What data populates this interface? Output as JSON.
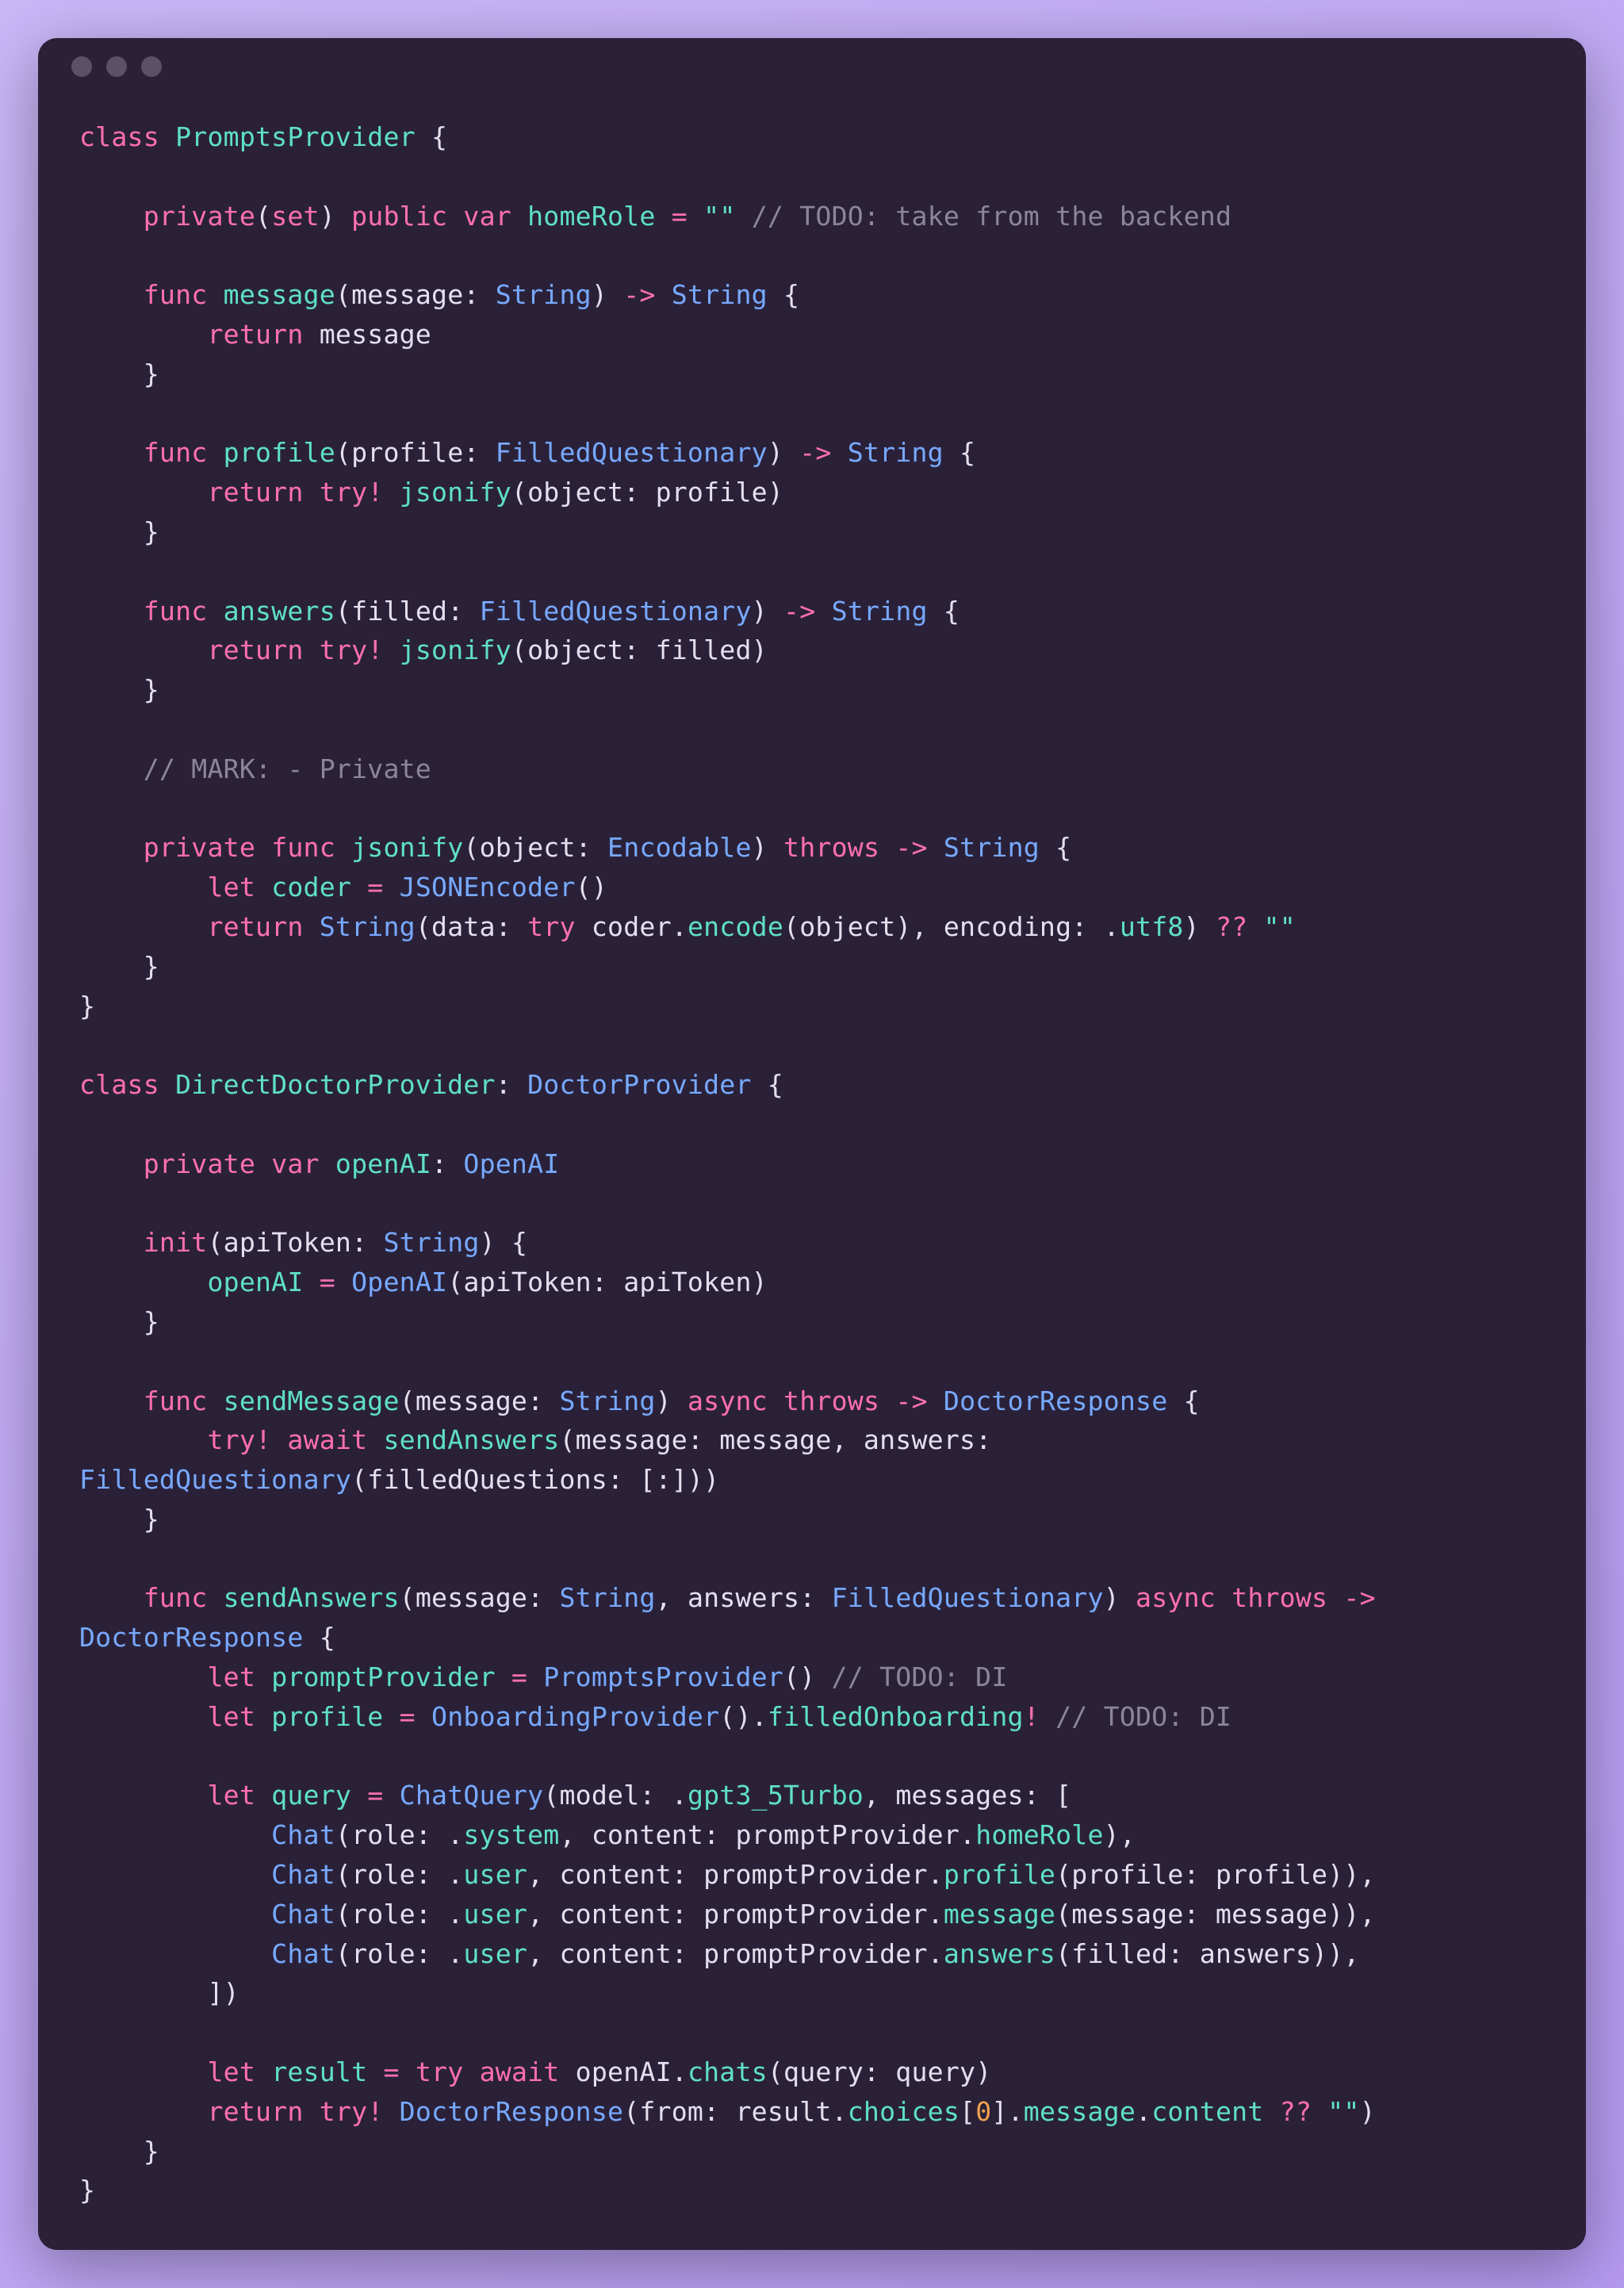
{
  "code_lines": [
    [
      [
        "kw",
        "class"
      ],
      [
        "pln",
        " "
      ],
      [
        "fn",
        "PromptsProvider"
      ],
      [
        "pln",
        " {"
      ]
    ],
    [],
    [
      [
        "pln",
        "    "
      ],
      [
        "kw2",
        "private"
      ],
      [
        "pln",
        "("
      ],
      [
        "kw2",
        "set"
      ],
      [
        "pln",
        ") "
      ],
      [
        "kw2",
        "public"
      ],
      [
        "pln",
        " "
      ],
      [
        "kw",
        "var"
      ],
      [
        "pln",
        " "
      ],
      [
        "fn",
        "homeRole"
      ],
      [
        "pln",
        " "
      ],
      [
        "op",
        "="
      ],
      [
        "pln",
        " "
      ],
      [
        "str",
        "\"\""
      ],
      [
        "pln",
        " "
      ],
      [
        "cmt",
        "// TODO: take from the backend"
      ]
    ],
    [],
    [
      [
        "pln",
        "    "
      ],
      [
        "kw",
        "func"
      ],
      [
        "pln",
        " "
      ],
      [
        "fn",
        "message"
      ],
      [
        "pln",
        "("
      ],
      [
        "lbl",
        "message"
      ],
      [
        "pln",
        ": "
      ],
      [
        "typ",
        "String"
      ],
      [
        "pln",
        ") "
      ],
      [
        "op",
        "->"
      ],
      [
        "pln",
        " "
      ],
      [
        "typ",
        "String"
      ],
      [
        "pln",
        " {"
      ]
    ],
    [
      [
        "pln",
        "        "
      ],
      [
        "kw",
        "return"
      ],
      [
        "pln",
        " message"
      ]
    ],
    [
      [
        "pln",
        "    }"
      ]
    ],
    [],
    [
      [
        "pln",
        "    "
      ],
      [
        "kw",
        "func"
      ],
      [
        "pln",
        " "
      ],
      [
        "fn",
        "profile"
      ],
      [
        "pln",
        "("
      ],
      [
        "lbl",
        "profile"
      ],
      [
        "pln",
        ": "
      ],
      [
        "typ",
        "FilledQuestionary"
      ],
      [
        "pln",
        ") "
      ],
      [
        "op",
        "->"
      ],
      [
        "pln",
        " "
      ],
      [
        "typ",
        "String"
      ],
      [
        "pln",
        " {"
      ]
    ],
    [
      [
        "pln",
        "        "
      ],
      [
        "kw",
        "return"
      ],
      [
        "pln",
        " "
      ],
      [
        "kw",
        "try!"
      ],
      [
        "pln",
        " "
      ],
      [
        "fn",
        "jsonify"
      ],
      [
        "pln",
        "("
      ],
      [
        "lbl",
        "object"
      ],
      [
        "pln",
        ": profile)"
      ]
    ],
    [
      [
        "pln",
        "    }"
      ]
    ],
    [],
    [
      [
        "pln",
        "    "
      ],
      [
        "kw",
        "func"
      ],
      [
        "pln",
        " "
      ],
      [
        "fn",
        "answers"
      ],
      [
        "pln",
        "("
      ],
      [
        "lbl",
        "filled"
      ],
      [
        "pln",
        ": "
      ],
      [
        "typ",
        "FilledQuestionary"
      ],
      [
        "pln",
        ") "
      ],
      [
        "op",
        "->"
      ],
      [
        "pln",
        " "
      ],
      [
        "typ",
        "String"
      ],
      [
        "pln",
        " {"
      ]
    ],
    [
      [
        "pln",
        "        "
      ],
      [
        "kw",
        "return"
      ],
      [
        "pln",
        " "
      ],
      [
        "kw",
        "try!"
      ],
      [
        "pln",
        " "
      ],
      [
        "fn",
        "jsonify"
      ],
      [
        "pln",
        "("
      ],
      [
        "lbl",
        "object"
      ],
      [
        "pln",
        ": filled)"
      ]
    ],
    [
      [
        "pln",
        "    }"
      ]
    ],
    [],
    [
      [
        "pln",
        "    "
      ],
      [
        "cmt",
        "// MARK: - Private"
      ]
    ],
    [],
    [
      [
        "pln",
        "    "
      ],
      [
        "kw2",
        "private"
      ],
      [
        "pln",
        " "
      ],
      [
        "kw",
        "func"
      ],
      [
        "pln",
        " "
      ],
      [
        "fn",
        "jsonify"
      ],
      [
        "pln",
        "("
      ],
      [
        "lbl",
        "object"
      ],
      [
        "pln",
        ": "
      ],
      [
        "typ",
        "Encodable"
      ],
      [
        "pln",
        ") "
      ],
      [
        "kw",
        "throws"
      ],
      [
        "pln",
        " "
      ],
      [
        "op",
        "->"
      ],
      [
        "pln",
        " "
      ],
      [
        "typ",
        "String"
      ],
      [
        "pln",
        " {"
      ]
    ],
    [
      [
        "pln",
        "        "
      ],
      [
        "kw",
        "let"
      ],
      [
        "pln",
        " "
      ],
      [
        "fn",
        "coder"
      ],
      [
        "pln",
        " "
      ],
      [
        "op",
        "="
      ],
      [
        "pln",
        " "
      ],
      [
        "typ",
        "JSONEncoder"
      ],
      [
        "pln",
        "()"
      ]
    ],
    [
      [
        "pln",
        "        "
      ],
      [
        "kw",
        "return"
      ],
      [
        "pln",
        " "
      ],
      [
        "typ",
        "String"
      ],
      [
        "pln",
        "("
      ],
      [
        "lbl",
        "data"
      ],
      [
        "pln",
        ": "
      ],
      [
        "kw",
        "try"
      ],
      [
        "pln",
        " coder."
      ],
      [
        "fn",
        "encode"
      ],
      [
        "pln",
        "(object), "
      ],
      [
        "lbl",
        "encoding"
      ],
      [
        "pln",
        ": ."
      ],
      [
        "fn",
        "utf8"
      ],
      [
        "pln",
        ") "
      ],
      [
        "op",
        "??"
      ],
      [
        "pln",
        " "
      ],
      [
        "str",
        "\"\""
      ]
    ],
    [
      [
        "pln",
        "    }"
      ]
    ],
    [
      [
        "pln",
        "}"
      ]
    ],
    [],
    [
      [
        "kw",
        "class"
      ],
      [
        "pln",
        " "
      ],
      [
        "fn",
        "DirectDoctorProvider"
      ],
      [
        "pln",
        ": "
      ],
      [
        "typ",
        "DoctorProvider"
      ],
      [
        "pln",
        " {"
      ]
    ],
    [],
    [
      [
        "pln",
        "    "
      ],
      [
        "kw2",
        "private"
      ],
      [
        "pln",
        " "
      ],
      [
        "kw",
        "var"
      ],
      [
        "pln",
        " "
      ],
      [
        "fn",
        "openAI"
      ],
      [
        "pln",
        ": "
      ],
      [
        "typ",
        "OpenAI"
      ]
    ],
    [],
    [
      [
        "pln",
        "    "
      ],
      [
        "kw",
        "init"
      ],
      [
        "pln",
        "("
      ],
      [
        "lbl",
        "apiToken"
      ],
      [
        "pln",
        ": "
      ],
      [
        "typ",
        "String"
      ],
      [
        "pln",
        ") {"
      ]
    ],
    [
      [
        "pln",
        "        "
      ],
      [
        "fn",
        "openAI"
      ],
      [
        "pln",
        " "
      ],
      [
        "op",
        "="
      ],
      [
        "pln",
        " "
      ],
      [
        "typ",
        "OpenAI"
      ],
      [
        "pln",
        "("
      ],
      [
        "lbl",
        "apiToken"
      ],
      [
        "pln",
        ": apiToken)"
      ]
    ],
    [
      [
        "pln",
        "    }"
      ]
    ],
    [],
    [
      [
        "pln",
        "    "
      ],
      [
        "kw",
        "func"
      ],
      [
        "pln",
        " "
      ],
      [
        "fn",
        "sendMessage"
      ],
      [
        "pln",
        "("
      ],
      [
        "lbl",
        "message"
      ],
      [
        "pln",
        ": "
      ],
      [
        "typ",
        "String"
      ],
      [
        "pln",
        ") "
      ],
      [
        "kw",
        "async"
      ],
      [
        "pln",
        " "
      ],
      [
        "kw",
        "throws"
      ],
      [
        "pln",
        " "
      ],
      [
        "op",
        "->"
      ],
      [
        "pln",
        " "
      ],
      [
        "typ",
        "DoctorResponse"
      ],
      [
        "pln",
        " {"
      ]
    ],
    [
      [
        "pln",
        "        "
      ],
      [
        "kw",
        "try!"
      ],
      [
        "pln",
        " "
      ],
      [
        "kw",
        "await"
      ],
      [
        "pln",
        " "
      ],
      [
        "fn",
        "sendAnswers"
      ],
      [
        "pln",
        "("
      ],
      [
        "lbl",
        "message"
      ],
      [
        "pln",
        ": message, "
      ],
      [
        "lbl",
        "answers"
      ],
      [
        "pln",
        ": "
      ],
      [
        "typ",
        "FilledQuestionary"
      ],
      [
        "pln",
        "("
      ],
      [
        "lbl",
        "filledQuestions"
      ],
      [
        "pln",
        ": [:]))"
      ]
    ],
    [
      [
        "pln",
        "    }"
      ]
    ],
    [],
    [
      [
        "pln",
        "    "
      ],
      [
        "kw",
        "func"
      ],
      [
        "pln",
        " "
      ],
      [
        "fn",
        "sendAnswers"
      ],
      [
        "pln",
        "("
      ],
      [
        "lbl",
        "message"
      ],
      [
        "pln",
        ": "
      ],
      [
        "typ",
        "String"
      ],
      [
        "pln",
        ", "
      ],
      [
        "lbl",
        "answers"
      ],
      [
        "pln",
        ": "
      ],
      [
        "typ",
        "FilledQuestionary"
      ],
      [
        "pln",
        ") "
      ],
      [
        "kw",
        "async"
      ],
      [
        "pln",
        " "
      ],
      [
        "kw",
        "throws"
      ],
      [
        "pln",
        " "
      ],
      [
        "op",
        "->"
      ],
      [
        "pln",
        " "
      ],
      [
        "typ",
        "DoctorResponse"
      ],
      [
        "pln",
        " {"
      ]
    ],
    [
      [
        "pln",
        "        "
      ],
      [
        "kw",
        "let"
      ],
      [
        "pln",
        " "
      ],
      [
        "fn",
        "promptProvider"
      ],
      [
        "pln",
        " "
      ],
      [
        "op",
        "="
      ],
      [
        "pln",
        " "
      ],
      [
        "typ",
        "PromptsProvider"
      ],
      [
        "pln",
        "() "
      ],
      [
        "cmt",
        "// TODO: DI"
      ]
    ],
    [
      [
        "pln",
        "        "
      ],
      [
        "kw",
        "let"
      ],
      [
        "pln",
        " "
      ],
      [
        "fn",
        "profile"
      ],
      [
        "pln",
        " "
      ],
      [
        "op",
        "="
      ],
      [
        "pln",
        " "
      ],
      [
        "typ",
        "OnboardingProvider"
      ],
      [
        "pln",
        "()."
      ],
      [
        "fn",
        "filledOnboarding"
      ],
      [
        "op",
        "!"
      ],
      [
        "pln",
        " "
      ],
      [
        "cmt",
        "// TODO: DI"
      ]
    ],
    [],
    [
      [
        "pln",
        "        "
      ],
      [
        "kw",
        "let"
      ],
      [
        "pln",
        " "
      ],
      [
        "fn",
        "query"
      ],
      [
        "pln",
        " "
      ],
      [
        "op",
        "="
      ],
      [
        "pln",
        " "
      ],
      [
        "typ",
        "ChatQuery"
      ],
      [
        "pln",
        "("
      ],
      [
        "lbl",
        "model"
      ],
      [
        "pln",
        ": ."
      ],
      [
        "fn",
        "gpt3_5Turbo"
      ],
      [
        "pln",
        ", "
      ],
      [
        "lbl",
        "messages"
      ],
      [
        "pln",
        ": ["
      ]
    ],
    [
      [
        "pln",
        "            "
      ],
      [
        "typ",
        "Chat"
      ],
      [
        "pln",
        "("
      ],
      [
        "lbl",
        "role"
      ],
      [
        "pln",
        ": ."
      ],
      [
        "fn",
        "system"
      ],
      [
        "pln",
        ", "
      ],
      [
        "lbl",
        "content"
      ],
      [
        "pln",
        ": promptProvider."
      ],
      [
        "fn",
        "homeRole"
      ],
      [
        "pln",
        "),"
      ]
    ],
    [
      [
        "pln",
        "            "
      ],
      [
        "typ",
        "Chat"
      ],
      [
        "pln",
        "("
      ],
      [
        "lbl",
        "role"
      ],
      [
        "pln",
        ": ."
      ],
      [
        "fn",
        "user"
      ],
      [
        "pln",
        ", "
      ],
      [
        "lbl",
        "content"
      ],
      [
        "pln",
        ": promptProvider."
      ],
      [
        "fn",
        "profile"
      ],
      [
        "pln",
        "("
      ],
      [
        "lbl",
        "profile"
      ],
      [
        "pln",
        ": profile)),"
      ]
    ],
    [
      [
        "pln",
        "            "
      ],
      [
        "typ",
        "Chat"
      ],
      [
        "pln",
        "("
      ],
      [
        "lbl",
        "role"
      ],
      [
        "pln",
        ": ."
      ],
      [
        "fn",
        "user"
      ],
      [
        "pln",
        ", "
      ],
      [
        "lbl",
        "content"
      ],
      [
        "pln",
        ": promptProvider."
      ],
      [
        "fn",
        "message"
      ],
      [
        "pln",
        "("
      ],
      [
        "lbl",
        "message"
      ],
      [
        "pln",
        ": message)),"
      ]
    ],
    [
      [
        "pln",
        "            "
      ],
      [
        "typ",
        "Chat"
      ],
      [
        "pln",
        "("
      ],
      [
        "lbl",
        "role"
      ],
      [
        "pln",
        ": ."
      ],
      [
        "fn",
        "user"
      ],
      [
        "pln",
        ", "
      ],
      [
        "lbl",
        "content"
      ],
      [
        "pln",
        ": promptProvider."
      ],
      [
        "fn",
        "answers"
      ],
      [
        "pln",
        "("
      ],
      [
        "lbl",
        "filled"
      ],
      [
        "pln",
        ": answers)),"
      ]
    ],
    [
      [
        "pln",
        "        ])"
      ]
    ],
    [],
    [
      [
        "pln",
        "        "
      ],
      [
        "kw",
        "let"
      ],
      [
        "pln",
        " "
      ],
      [
        "fn",
        "result"
      ],
      [
        "pln",
        " "
      ],
      [
        "op",
        "="
      ],
      [
        "pln",
        " "
      ],
      [
        "kw",
        "try"
      ],
      [
        "pln",
        " "
      ],
      [
        "kw",
        "await"
      ],
      [
        "pln",
        " openAI."
      ],
      [
        "fn",
        "chats"
      ],
      [
        "pln",
        "("
      ],
      [
        "lbl",
        "query"
      ],
      [
        "pln",
        ": query)"
      ]
    ],
    [
      [
        "pln",
        "        "
      ],
      [
        "kw",
        "return"
      ],
      [
        "pln",
        " "
      ],
      [
        "kw",
        "try!"
      ],
      [
        "pln",
        " "
      ],
      [
        "typ",
        "DoctorResponse"
      ],
      [
        "pln",
        "("
      ],
      [
        "lbl",
        "from"
      ],
      [
        "pln",
        ": result."
      ],
      [
        "fn",
        "choices"
      ],
      [
        "pln",
        "["
      ],
      [
        "num",
        "0"
      ],
      [
        "pln",
        "]."
      ],
      [
        "fn",
        "message"
      ],
      [
        "pln",
        "."
      ],
      [
        "fn",
        "content"
      ],
      [
        "pln",
        " "
      ],
      [
        "op",
        "??"
      ],
      [
        "pln",
        " "
      ],
      [
        "str",
        "\"\""
      ],
      [
        "pln",
        ")"
      ]
    ],
    [
      [
        "pln",
        "    }"
      ]
    ],
    [
      [
        "pln",
        "}"
      ]
    ]
  ]
}
